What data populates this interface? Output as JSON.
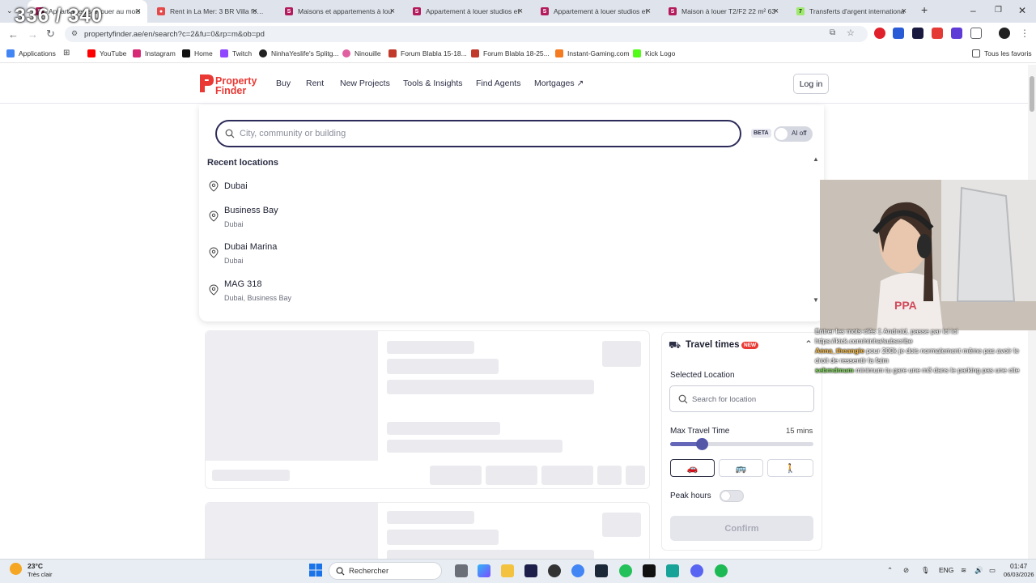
{
  "browser": {
    "tabs": [
      {
        "title": "Appartements à louer au mois",
        "active": true,
        "favicon_color": "#b31b5c"
      },
      {
        "title": "Rent in La Mer: 3 BR Villa for Re",
        "active": false,
        "favicon_color": "#e44a4a"
      },
      {
        "title": "Maisons et appartements à lou",
        "active": false,
        "favicon_color": "#b31b5c"
      },
      {
        "title": "Appartement à louer studios et",
        "active": false,
        "favicon_color": "#b31b5c"
      },
      {
        "title": "Appartement à louer studios et",
        "active": false,
        "favicon_color": "#b31b5c"
      },
      {
        "title": "Maison à louer T2/F2 22 m² 63",
        "active": false,
        "favicon_color": "#b31b5c"
      },
      {
        "title": "Transferts d'argent internationa",
        "active": false,
        "favicon_color": "#9fe870"
      }
    ],
    "url": "propertyfinder.ae/en/search?c=2&fu=0&rp=m&ob=pd",
    "bookmarks": [
      {
        "label": "Applications",
        "color": "#4285f4"
      },
      {
        "label": "YouTube",
        "color": "#ff0000"
      },
      {
        "label": "Instagram",
        "color": "#d62976"
      },
      {
        "label": "Home",
        "color": "#111111"
      },
      {
        "label": "Twitch",
        "color": "#9146ff"
      },
      {
        "label": "NinhaYeslife's Splitg...",
        "color": "#222222"
      },
      {
        "label": "Ninouille",
        "color": "#e05fa0"
      },
      {
        "label": "Forum Blabla 15-18...",
        "color": "#c0392b"
      },
      {
        "label": "Forum Blabla 18-25...",
        "color": "#c0392b"
      },
      {
        "label": "Instant-Gaming.com",
        "color": "#f47b20"
      },
      {
        "label": "Kick Logo",
        "color": "#53fc18"
      }
    ],
    "all_favorites": "Tous les favoris"
  },
  "site": {
    "logo_line1": "Property",
    "logo_line2": "Finder",
    "nav": [
      "Buy",
      "Rent",
      "New Projects",
      "Tools & Insights",
      "Find Agents",
      "Mortgages ↗"
    ],
    "login": "Log in"
  },
  "search": {
    "placeholder": "City, community or building",
    "beta": "BETA",
    "ai_label": "AI off",
    "recent_heading": "Recent locations",
    "recent": [
      {
        "name": "Dubai",
        "sub": ""
      },
      {
        "name": "Business Bay",
        "sub": "Dubai"
      },
      {
        "name": "Dubai Marina",
        "sub": "Dubai"
      },
      {
        "name": "MAG 318",
        "sub": "Dubai, Business Bay"
      }
    ]
  },
  "travel": {
    "title": "Travel times",
    "badge": "NEW",
    "selected_location": "Selected Location",
    "search_placeholder": "Search for location",
    "max_travel_time": "Max Travel Time",
    "max_value": "15 mins",
    "slider_fraction": 0.22,
    "peak_hours": "Peak hours",
    "confirm": "Confirm"
  },
  "stream": {
    "counter": "336 / 340",
    "chat": [
      {
        "user": "",
        "text": "Entrer les mots-clés 1 Android, passe par ici ici"
      },
      {
        "user": "",
        "text": "https://kick.com/ninha/subscribe"
      },
      {
        "user": "Anna_theangie",
        "text": "pour 200k je dois normalement même pas avoir le droit de ressentir la faim"
      },
      {
        "user": "sebmdmum",
        "text": "minimum tu gare une m3 dans le parking pas une cite"
      }
    ]
  },
  "taskbar": {
    "weather_temp": "23°C",
    "weather_desc": "Très clair",
    "search": "Rechercher",
    "lang": "ENG",
    "time": "01:47",
    "date": "06/03/2026"
  }
}
